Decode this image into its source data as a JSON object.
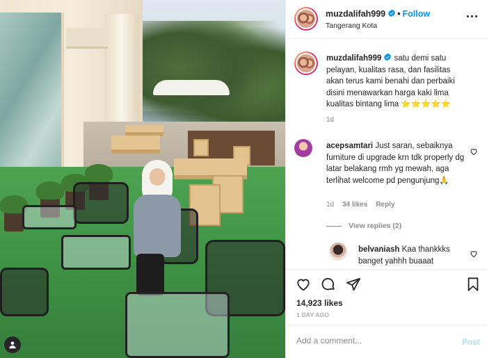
{
  "post": {
    "username": "muzdalifah999",
    "follow_label": "Follow",
    "location": "Tangerang Kota",
    "separator": "•",
    "likes": "14,923 likes",
    "time_ago": "1 DAY AGO"
  },
  "caption": {
    "username": "muzdalifah999",
    "text": "satu demi satu pelayan, kualitas rasa, dan fasilitas akan terus kami benahi dan perbaiki disini menawarkan harga kaki lima kualitas bintang lima ⭐⭐⭐⭐⭐",
    "time": "1d"
  },
  "comments": [
    {
      "username": "acepsamtari",
      "text": "Just saran, sebaiknya furniture di upgrade krn tdk properly dg latar belakang rmh yg mewah, aga terlihat welcome pd pengunjung🙏",
      "time": "1d",
      "likes": "34 likes",
      "reply_label": "Reply"
    }
  ],
  "view_replies": "View replies (2)",
  "reply": {
    "username": "belvaniash",
    "text": "Kaa thankkks banget yahhh buaaat"
  },
  "add_comment": {
    "placeholder": "Add a comment...",
    "post_label": "Post"
  },
  "icons": {
    "verified": "verified-badge-icon",
    "more": "more-options-icon",
    "like": "heart-icon",
    "comment": "comment-icon",
    "share": "share-icon",
    "save": "bookmark-icon",
    "tag": "user-tag-icon"
  },
  "colors": {
    "accent": "#0095f6",
    "text": "#262626",
    "muted": "#8e8e8e",
    "post_disabled": "#b2dffc"
  }
}
